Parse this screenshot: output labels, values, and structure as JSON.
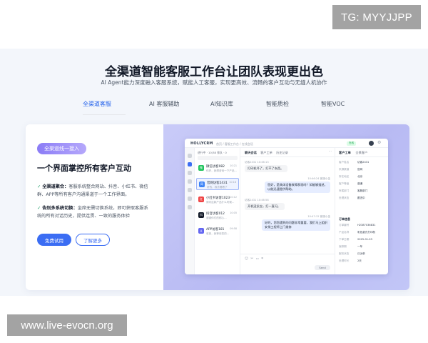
{
  "watermarks": {
    "top": "TG: MYYJJPP",
    "bottom": "www.live-evocn.org"
  },
  "hero": {
    "title": "全渠道智能客服工作台让团队表现更出色",
    "subtitle": "AI Agent能力深度融入客服系统，赋能人工客服，实现更高效、流畅的客户互动与无缝人机协作"
  },
  "tabs": [
    {
      "label": "全渠道客服",
      "active": true
    },
    {
      "label": "AI 客服辅助",
      "active": false
    },
    {
      "label": "AI知识库",
      "active": false
    },
    {
      "label": "智能质检",
      "active": false
    },
    {
      "label": "智能VOC",
      "active": false
    }
  ],
  "panel": {
    "badge": "全渠道线一接入",
    "title": "一个界面掌控所有客户互动",
    "features": [
      {
        "heading": "全渠道聚合：",
        "text": "客服系统整合网站、抖音、小红书、微信群、APP等所有客户沟通渠道于一个工作界面。"
      },
      {
        "heading": "告别多系统切换：",
        "text": "坐席无需切换系统，即可获取客服系统的所有对话历史，提供连贯、一致的服务体验"
      }
    ],
    "primary_button": "免费试用",
    "secondary_button": "了解更多"
  },
  "app": {
    "logo": "HOLLYCRM",
    "breadcrumb": "首页 / 客服工作台 / 在线会话",
    "status": "在线",
    "list_tabs": "进行中 · 10/38    排队 · 0",
    "conversations": [
      {
        "name": "微信访客082",
        "preview": "你好，我想咨询一下产品...",
        "time": "10:21",
        "icon": "wechat",
        "color": "#22c55e",
        "glyph": "微",
        "active": false
      },
      {
        "name": "官网访客2431",
        "preview": "好的，我去看看了",
        "time": "10:18",
        "icon": "web",
        "color": "#3b82f6",
        "glyph": "网",
        "active": true
      },
      {
        "name": "小红书访客1023",
        "preview": "请问这款产品什么时候...",
        "time": "10:12",
        "icon": "xiaohongshu",
        "color": "#ef4444",
        "glyph": "红",
        "active": false
      },
      {
        "name": "抖音访客012",
        "preview": "谢谢你们的耐心...",
        "time": "10:05",
        "icon": "douyin",
        "color": "#111827",
        "glyph": "抖",
        "active": false
      },
      {
        "name": "APP访客181",
        "preview": "收到，我等待您的...",
        "time": "09:58",
        "icon": "app",
        "color": "#6366f1",
        "glyph": "A",
        "active": false
      }
    ],
    "chat_tabs": [
      "聊天会话",
      "客户工单",
      "历史记录"
    ],
    "messages": [
      {
        "meta": "访客2431  10:46:13",
        "text": "打印机坏了，打不了东西。",
        "side": "in"
      },
      {
        "meta": "10:46:24  客服小金",
        "text": "您好，是具体设备故障表现吗？如能够描述，以能迅速提供帮助。",
        "side": "out"
      },
      {
        "meta": "访客2431  10:46:58",
        "text": "开机没反应，打一直闪。",
        "side": "in"
      },
      {
        "meta": "10:47:12  客服小金",
        "text": "好的，您您遇到的问题非常重要，我们马上组织安排工程师上门维修",
        "side": "out"
      }
    ],
    "send": "Send",
    "info_tabs": [
      "客户工单",
      "全景客户"
    ],
    "info_rows": [
      {
        "k": "客户姓名",
        "v": "访客2431"
      },
      {
        "k": "来源渠道",
        "v": "官网"
      },
      {
        "k": "所在地区",
        "v": "北京"
      },
      {
        "k": "客户等级",
        "v": "普通"
      },
      {
        "k": "所属部门",
        "v": "客服部门"
      },
      {
        "k": "处理状态",
        "v": "跟进中"
      }
    ],
    "info_section": "订单信息",
    "order_rows": [
      {
        "k": "订单编号",
        "v": "H2387036831"
      },
      {
        "k": "产品名称",
        "v": "彩色激光打印机"
      },
      {
        "k": "下单日期",
        "v": "2025-01-03"
      },
      {
        "k": "保修期",
        "v": "一年"
      },
      {
        "k": "服务状态",
        "v": "已派单"
      },
      {
        "k": "处理时长",
        "v": "2天"
      }
    ]
  }
}
